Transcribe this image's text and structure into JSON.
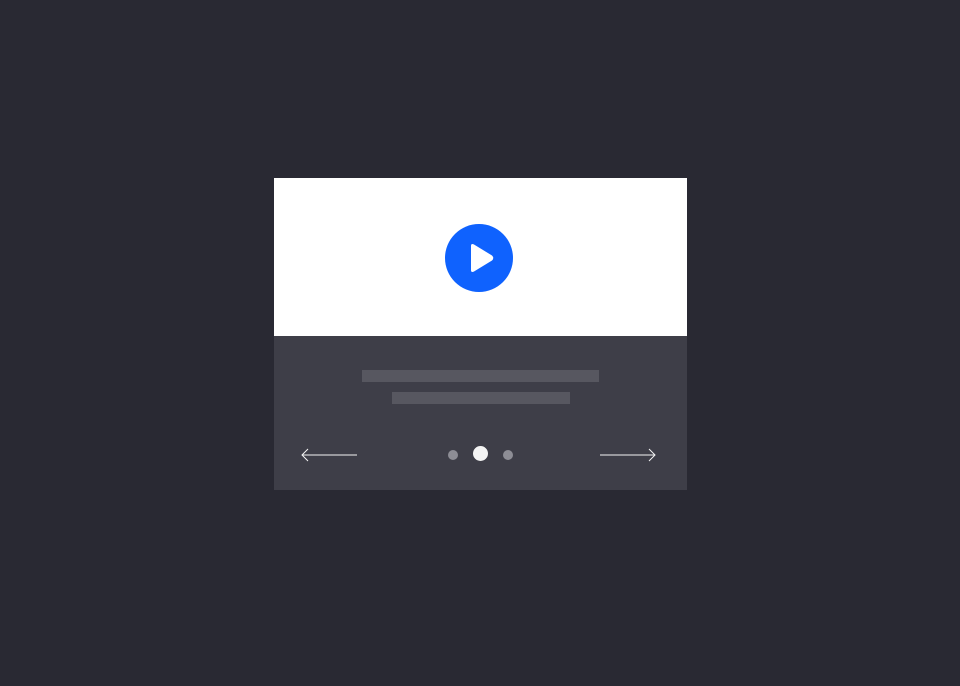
{
  "colors": {
    "page_background": "#292933",
    "media_background": "#ffffff",
    "play_button": "#0f62fe",
    "play_glyph": "#ffffff",
    "footer_background": "#3e3e48",
    "placeholder_line": "#575760",
    "arrow_stroke": "#f4f4f4",
    "dot_active": "#f4f4f4",
    "dot_inactive": "#8d8d95"
  },
  "icons": {
    "play": "play-icon",
    "prev": "arrow-left-icon",
    "next": "arrow-right-icon"
  },
  "carousel": {
    "slide_count": 3,
    "active_index": 1
  }
}
